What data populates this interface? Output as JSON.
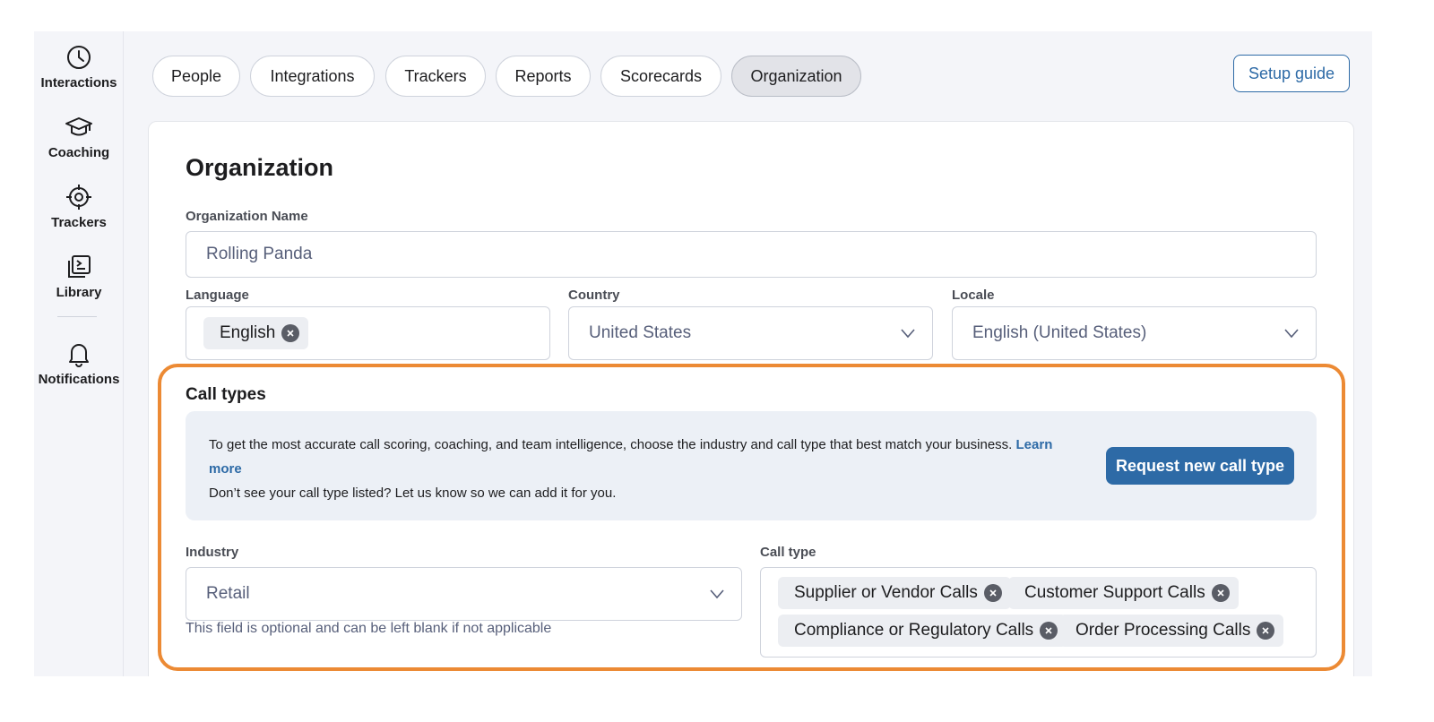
{
  "sidebar": {
    "items": [
      {
        "label": "Interactions",
        "icon": "clock-icon"
      },
      {
        "label": "Coaching",
        "icon": "graduation-cap-icon"
      },
      {
        "label": "Trackers",
        "icon": "crosshair-icon"
      },
      {
        "label": "Library",
        "icon": "library-icon"
      },
      {
        "label": "Notifications",
        "icon": "bell-icon"
      }
    ]
  },
  "tabs": [
    {
      "label": "People",
      "active": false
    },
    {
      "label": "Integrations",
      "active": false
    },
    {
      "label": "Trackers",
      "active": false
    },
    {
      "label": "Reports",
      "active": false
    },
    {
      "label": "Scorecards",
      "active": false
    },
    {
      "label": "Organization",
      "active": true
    }
  ],
  "setup_guide_label": "Setup guide",
  "page": {
    "title": "Organization",
    "org_name_label": "Organization Name",
    "org_name_value": "Rolling Panda",
    "language_label": "Language",
    "language_chip": "English",
    "country_label": "Country",
    "country_value": "United States",
    "locale_label": "Locale",
    "locale_value": "English (United States)"
  },
  "call_types": {
    "title": "Call types",
    "info_text": "To get the most accurate call scoring, coaching, and team intelligence, choose the industry and call type that best match your business.",
    "learn_more": "Learn more",
    "info_text2": "Don’t see your call type listed? Let us know so we can add it for you.",
    "request_button": "Request new call type",
    "industry_label": "Industry",
    "industry_value": "Retail",
    "industry_helper": "This field is optional and can be left blank if not applicable",
    "call_type_label": "Call type",
    "call_type_chips": [
      "Supplier or Vendor Calls",
      "Customer Support Calls",
      "Compliance or Regulatory Calls",
      "Order Processing Calls"
    ]
  },
  "colors": {
    "accent": "#2d6aa6",
    "highlight": "#ec8a34",
    "background": "#f4f5f9"
  }
}
